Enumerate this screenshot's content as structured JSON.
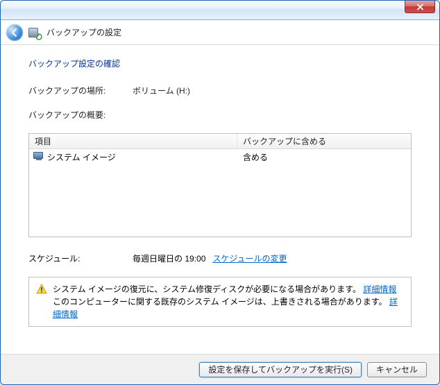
{
  "header": {
    "title": "バックアップの設定"
  },
  "main": {
    "section_title": "バックアップ設定の確認",
    "location_label": "バックアップの場所:",
    "location_value": "ボリューム (H:)",
    "summary_label": "バックアップの概要:"
  },
  "table": {
    "col1": "項目",
    "col2": "バックアップに含める",
    "rows": [
      {
        "name": "システム イメージ",
        "include": "含める"
      }
    ]
  },
  "schedule": {
    "label": "スケジュール:",
    "value": "毎週日曜日の 19:00",
    "change_link": "スケジュールの変更"
  },
  "warning": {
    "line1_text": "システム イメージの復元に、システム修復ディスクが必要になる場合があります。",
    "line1_link": "詳細情報",
    "line2_text": "このコンピューターに関する既存のシステム イメージは、上書きされる場合があります。",
    "line2_link": "詳細情報"
  },
  "footer": {
    "save_run": "設定を保存してバックアップを実行(S)",
    "cancel": "キャンセル"
  }
}
